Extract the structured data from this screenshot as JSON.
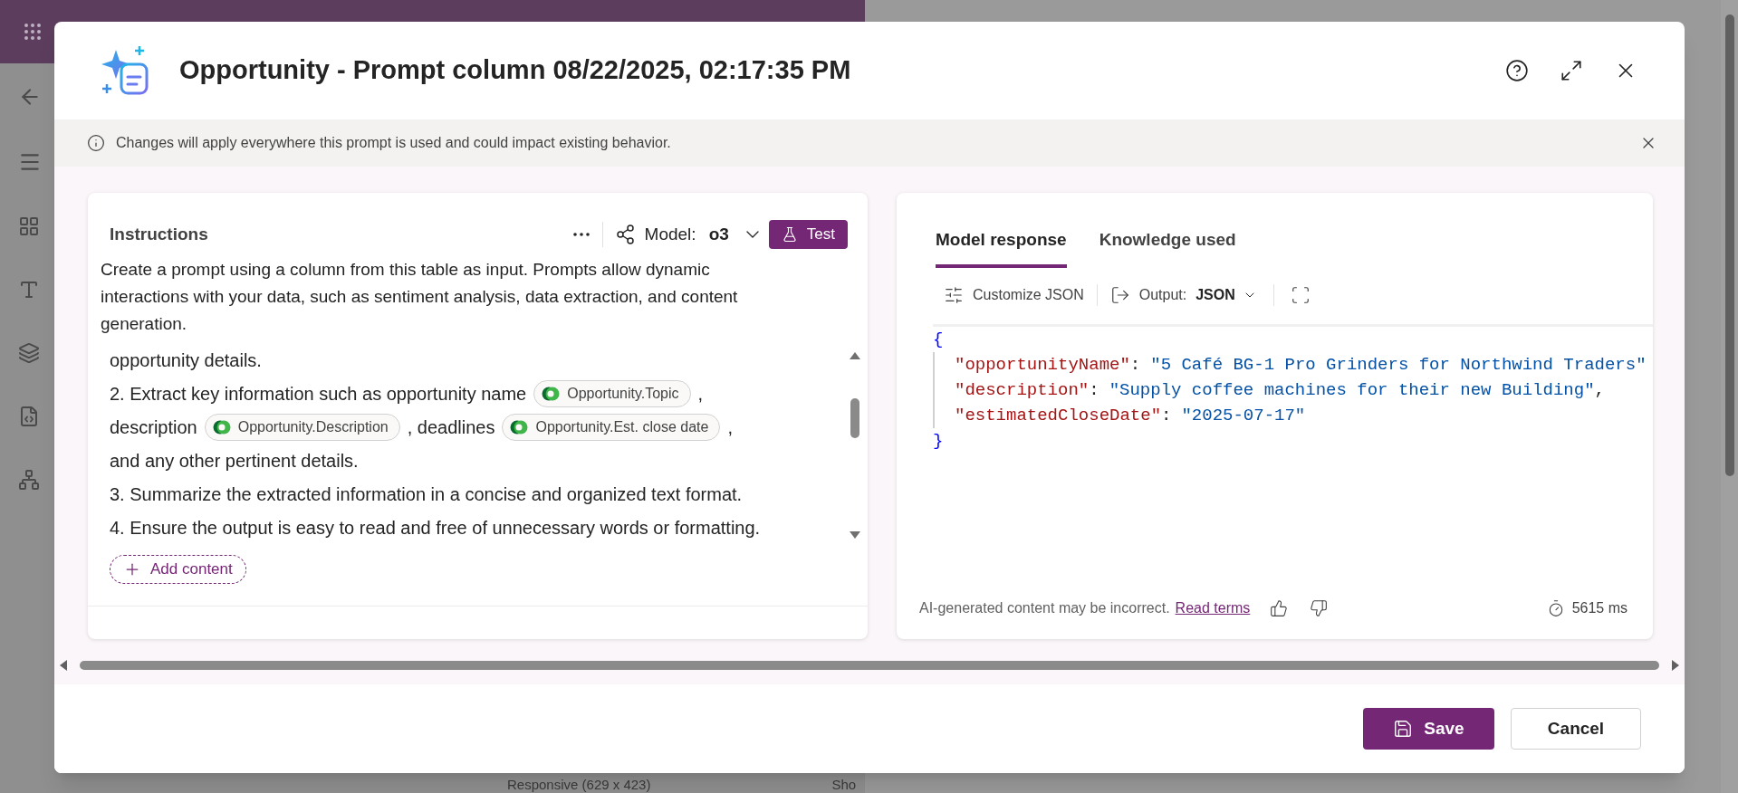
{
  "backdrop": {
    "texts": [
      "Responsive (629 x 423)",
      "Sho"
    ]
  },
  "dialog": {
    "title": "Opportunity - Prompt column 08/22/2025, 02:17:35 PM",
    "notice": "Changes will apply everywhere this prompt is used and could impact existing behavior.",
    "instructions": {
      "title": "Instructions",
      "model_label": "Model:",
      "model_value": "o3",
      "test_button": "Test",
      "description": "Create a prompt using a column from this table as input. Prompts allow dynamic interactions with your data, such as sentiment analysis, data extraction, and content generation.",
      "lines": [
        [
          {
            "kind": "text",
            "text": "opportunity details."
          }
        ],
        [
          {
            "kind": "text",
            "text": "2. Extract key information such as opportunity name"
          },
          {
            "kind": "chip",
            "text": "Opportunity.Topic"
          },
          {
            "kind": "text",
            "text": ","
          }
        ],
        [
          {
            "kind": "text",
            "text": "description"
          },
          {
            "kind": "chip",
            "text": "Opportunity.Description"
          },
          {
            "kind": "text",
            "text": ", deadlines"
          },
          {
            "kind": "chip",
            "text": "Opportunity.Est. close date"
          },
          {
            "kind": "text",
            "text": ","
          }
        ],
        [
          {
            "kind": "text",
            "text": "and any other pertinent details."
          }
        ],
        [
          {
            "kind": "text",
            "text": "3. Summarize the extracted information in a concise and organized text format."
          }
        ],
        [
          {
            "kind": "text",
            "text": "4. Ensure the output is easy to read and free of unnecessary words or formatting."
          }
        ]
      ],
      "add_content": "Add content"
    },
    "response": {
      "tabs": [
        {
          "label": "Model response",
          "selected": true
        },
        {
          "label": "Knowledge used",
          "selected": false
        }
      ],
      "customize": "Customize JSON",
      "output_label": "Output:",
      "output_value": "JSON",
      "code": {
        "open": "{",
        "close": "}",
        "lines": [
          {
            "key": "\"opportunityName\"",
            "sep": ":",
            "value": "\"5 Café BG-1 Pro Grinders for Northwind Traders\""
          },
          {
            "key": "\"description\"",
            "sep": ":",
            "value": "\"Supply coffee machines for their new Building\"",
            "end": ","
          },
          {
            "key": "\"estimatedCloseDate\"",
            "sep": ":",
            "value": "\"2025-07-17\""
          }
        ]
      },
      "disclaimer": "AI-generated content may be incorrect.",
      "link": "Read terms",
      "duration": "5615 ms"
    },
    "buttons": [
      {
        "label": "Save",
        "kind": "primary"
      },
      {
        "label": "Cancel",
        "kind": "secondary"
      }
    ]
  }
}
